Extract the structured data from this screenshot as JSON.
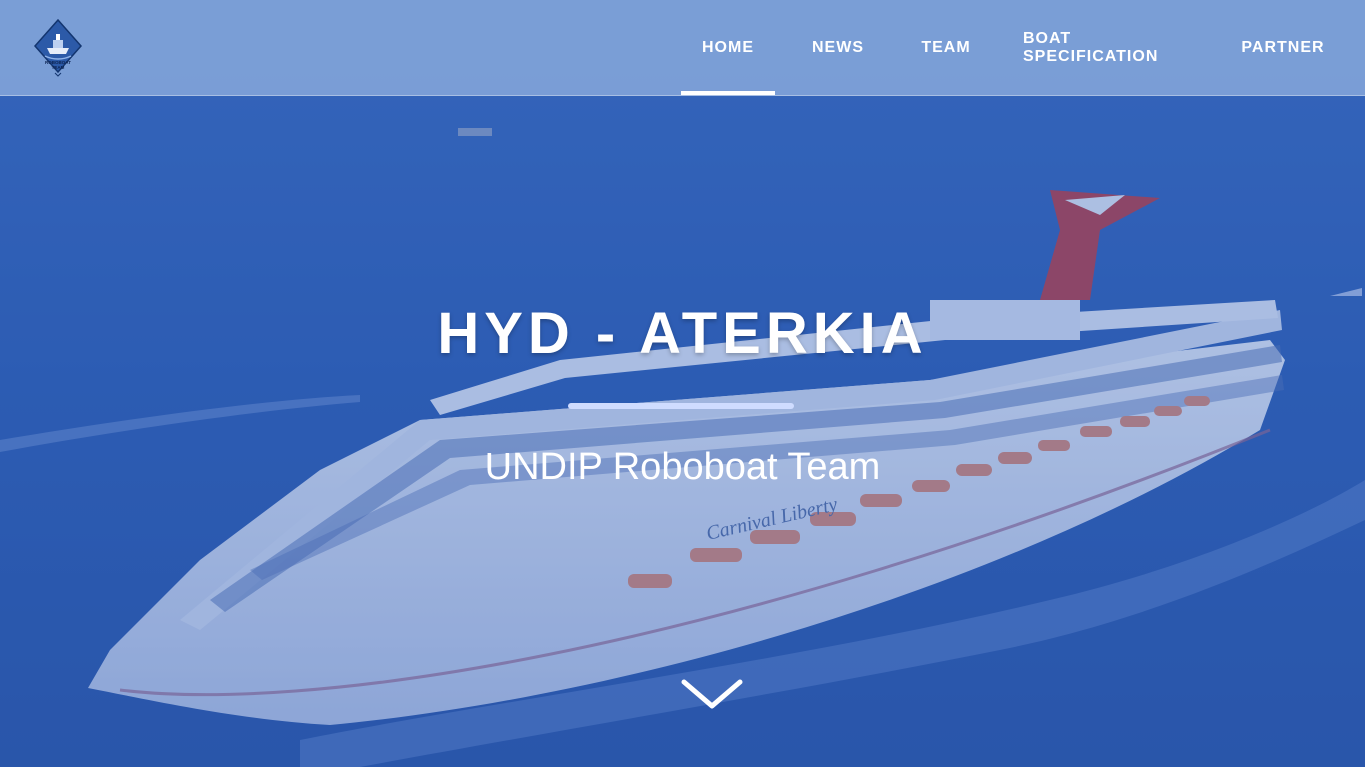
{
  "logo": {
    "icon": "boat-emblem-icon",
    "caption": "ROBOBOAT TEAM"
  },
  "nav": {
    "items": [
      {
        "label": "HOME",
        "active": true
      },
      {
        "label": "NEWS",
        "active": false
      },
      {
        "label": "TEAM",
        "active": false
      },
      {
        "label": "BOAT SPECIFICATION",
        "active": false
      },
      {
        "label": "PARTNER",
        "active": false
      }
    ]
  },
  "hero": {
    "title": "HYD - ATERKIA",
    "subtitle": "UNDIP Roboboat Team",
    "scroll_icon": "chevron-down-icon",
    "ship_name": "Carnival Liberty"
  },
  "colors": {
    "accent": "#ffffff",
    "overlay_blue": "#2d5bb0",
    "navbar": "#96b4e1"
  }
}
